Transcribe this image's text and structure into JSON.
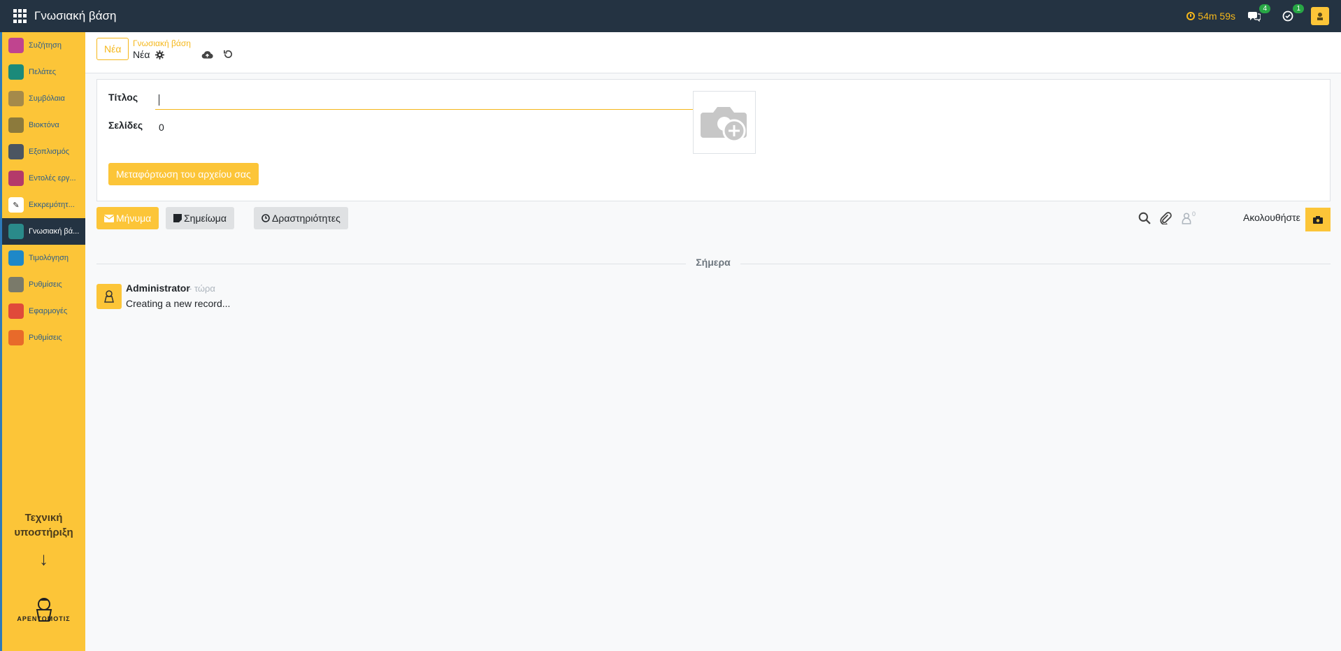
{
  "topbar": {
    "app_title": "Γνωσιακή βάση",
    "timer": "54m 59s",
    "messages_badge": "4",
    "activities_badge": "1"
  },
  "sidebar": {
    "items": [
      {
        "label": "Συζήτηση",
        "icon": "chat-icon",
        "color": "#c0448f"
      },
      {
        "label": "Πελάτες",
        "icon": "contacts-icon",
        "color": "#1b8a7a"
      },
      {
        "label": "Συμβόλαια",
        "icon": "contracts-icon",
        "color": "#a58a4a"
      },
      {
        "label": "Βιοκτόνα",
        "icon": "biocides-icon",
        "color": "#8c7a3c"
      },
      {
        "label": "Εξοπλισμός",
        "icon": "equipment-icon",
        "color": "#4b5561"
      },
      {
        "label": "Εντολές εργ...",
        "icon": "work-orders-icon",
        "color": "#b43a6a"
      },
      {
        "label": "Εκκρεμότητ...",
        "icon": "pending-icon",
        "color": "#ffffff"
      },
      {
        "label": "Γνωσιακή βά...",
        "icon": "knowledge-icon",
        "color": "#2a8a8a"
      },
      {
        "label": "Τιμολόγηση",
        "icon": "invoicing-icon",
        "color": "#1e88c8"
      },
      {
        "label": "Ρυθμίσεις",
        "icon": "settings-icon",
        "color": "#7a7a6a"
      },
      {
        "label": "Εφαρμογές",
        "icon": "apps-store-icon",
        "color": "#e04a3a"
      },
      {
        "label": "Ρυθμίσεις",
        "icon": "settings-alt-icon",
        "color": "#e86a2a"
      }
    ],
    "support_text": "Τεχνική υποστήριξη",
    "arrow": "↓",
    "logo_text": "ΑΡΕΝΤΟΜΟΤΙΣ"
  },
  "control": {
    "new_button": "Νέα",
    "breadcrumb_parent": "Γνωσιακή βάση",
    "breadcrumb_current": "Νέα"
  },
  "form": {
    "title_label": "Τίτλος",
    "title_value": "",
    "pages_label": "Σελίδες",
    "pages_value": "0",
    "upload_button": "Μεταφόρτωση του αρχείου σας"
  },
  "chatter": {
    "message_button": "Μήνυμα",
    "note_button": "Σημείωμα",
    "activities_button": "Δραστηριότητες",
    "followers_count": "0",
    "follow_label": "Ακολουθήστε",
    "date_separator": "Σήμερα",
    "message": {
      "author": "Administrator",
      "time": "- τώρα",
      "body": "Creating a new record..."
    }
  },
  "colors": {
    "accent": "#fcc538",
    "topbar": "#243342"
  }
}
